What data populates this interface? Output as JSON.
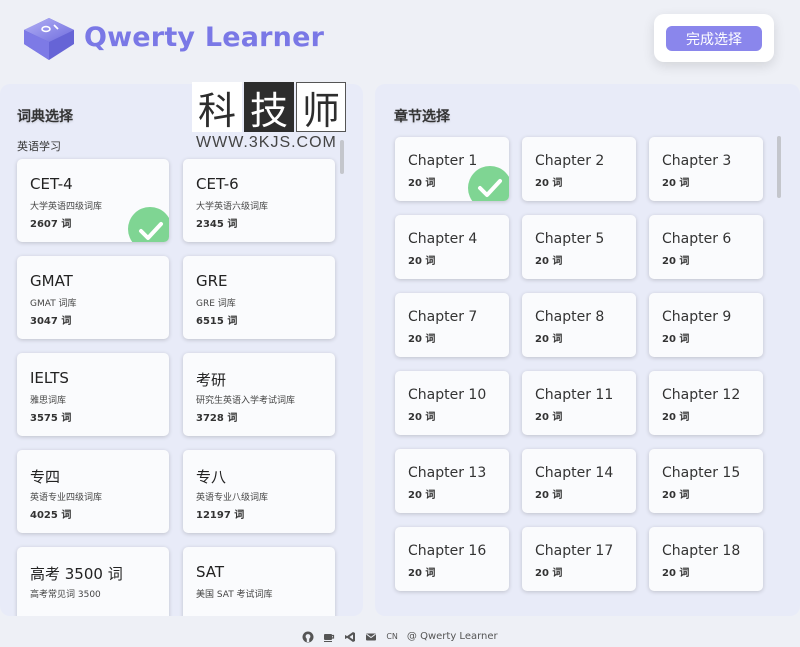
{
  "header": {
    "app_title": "Qwerty Learner",
    "done_button": "完成选择",
    "logo_icon": "keycap-logo-icon"
  },
  "dictionary_panel": {
    "title": "词典选择",
    "section_label": "英语学习",
    "selected": "CET-4",
    "items": [
      {
        "name": "CET-4",
        "desc": "大学英语四级词库",
        "count": "2607 词"
      },
      {
        "name": "CET-6",
        "desc": "大学英语六级词库",
        "count": "2345 词"
      },
      {
        "name": "GMAT",
        "desc": "GMAT 词库",
        "count": "3047 词"
      },
      {
        "name": "GRE",
        "desc": "GRE 词库",
        "count": "6515 词"
      },
      {
        "name": "IELTS",
        "desc": "雅思词库",
        "count": "3575 词"
      },
      {
        "name": "考研",
        "desc": "研究生英语入学考试词库",
        "count": "3728 词"
      },
      {
        "name": "专四",
        "desc": "英语专业四级词库",
        "count": "4025 词"
      },
      {
        "name": "专八",
        "desc": "英语专业八级词库",
        "count": "12197 词"
      },
      {
        "name": "高考 3500 词",
        "desc": "高考常见词 3500",
        "count": ""
      },
      {
        "name": "SAT",
        "desc": "美国 SAT 考试词库",
        "count": ""
      }
    ]
  },
  "chapter_panel": {
    "title": "章节选择",
    "selected": "Chapter 1",
    "items": [
      {
        "name": "Chapter 1",
        "count": "20 词"
      },
      {
        "name": "Chapter 2",
        "count": "20 词"
      },
      {
        "name": "Chapter 3",
        "count": "20 词"
      },
      {
        "name": "Chapter 4",
        "count": "20 词"
      },
      {
        "name": "Chapter 5",
        "count": "20 词"
      },
      {
        "name": "Chapter 6",
        "count": "20 词"
      },
      {
        "name": "Chapter 7",
        "count": "20 词"
      },
      {
        "name": "Chapter 8",
        "count": "20 词"
      },
      {
        "name": "Chapter 9",
        "count": "20 词"
      },
      {
        "name": "Chapter 10",
        "count": "20 词"
      },
      {
        "name": "Chapter 11",
        "count": "20 词"
      },
      {
        "name": "Chapter 12",
        "count": "20 词"
      },
      {
        "name": "Chapter 13",
        "count": "20 词"
      },
      {
        "name": "Chapter 14",
        "count": "20 词"
      },
      {
        "name": "Chapter 15",
        "count": "20 词"
      },
      {
        "name": "Chapter 16",
        "count": "20 词"
      },
      {
        "name": "Chapter 17",
        "count": "20 词"
      },
      {
        "name": "Chapter 18",
        "count": "20 词"
      }
    ]
  },
  "watermark": {
    "chars": [
      "科",
      "技",
      "师"
    ],
    "url": "WWW.3KJS.COM"
  },
  "footer": {
    "lang": "CN",
    "copyright": "@ Qwerty Learner",
    "icons": [
      "github-icon",
      "coffee-icon",
      "vscode-icon",
      "mail-icon"
    ]
  },
  "colors": {
    "brand": "#7a78e6",
    "button": "#8a86ec",
    "panel_bg": "#e8ebf8",
    "check": "#7fd593"
  }
}
